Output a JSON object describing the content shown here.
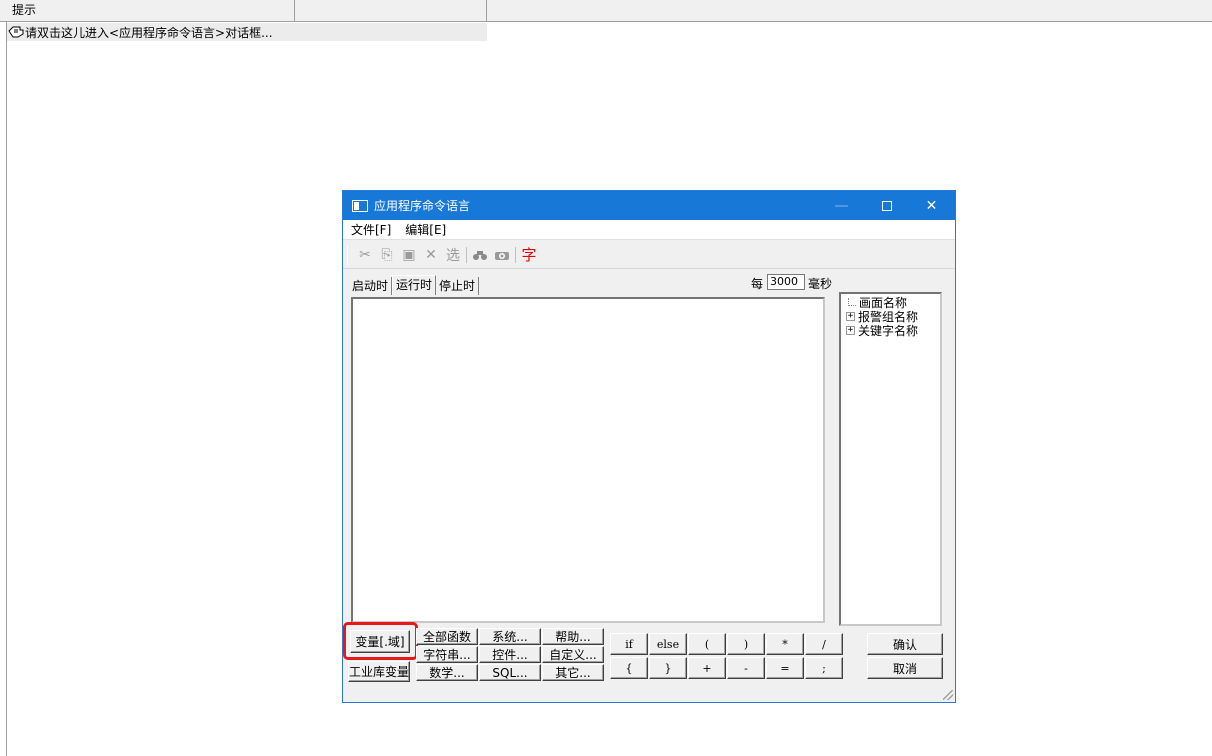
{
  "background": {
    "columns": [
      "提示",
      ""
    ],
    "row_text": "请双击这儿进入<应用程序命令语言>对话框..."
  },
  "dialog": {
    "title": "应用程序命令语言",
    "menu": [
      "文件[F]",
      "编辑[E]"
    ],
    "toolbar": {
      "cut": "✂",
      "copy": "⎘",
      "paste": "▣",
      "delete": "✕",
      "select": "选",
      "find": "🔭",
      "replace": "⚙",
      "font": "字"
    },
    "tabs": [
      "启动时",
      "运行时",
      "停止时"
    ],
    "active_tab": "运行时",
    "every_label": "每",
    "interval_value": "3000",
    "unit_label": "毫秒",
    "tree": {
      "items": [
        {
          "label": "画面名称",
          "expandable": false
        },
        {
          "label": "报警组名称",
          "expandable": true
        },
        {
          "label": "关键字名称",
          "expandable": true
        }
      ]
    },
    "buttons": {
      "variable": "变量[.域]",
      "industrial_var": "工业库变量",
      "all_functions": "全部函数",
      "string": "字符串...",
      "math": "数学...",
      "system": "系统...",
      "control": "控件...",
      "sql": "SQL...",
      "help": "帮助...",
      "custom": "自定义...",
      "other": "其它...",
      "op_if": "if",
      "op_else": "else",
      "op_lparen": "(",
      "op_rparen": ")",
      "op_mul": "*",
      "op_div": "/",
      "op_lbrace": "{",
      "op_rbrace": "}",
      "op_plus": "+",
      "op_minus": "-",
      "op_eq": "=",
      "op_semi": ";",
      "ok": "确认",
      "cancel": "取消"
    }
  },
  "colors": {
    "titlebar": "#1778d8",
    "highlight": "#e81818",
    "font_button": "#e00000"
  }
}
